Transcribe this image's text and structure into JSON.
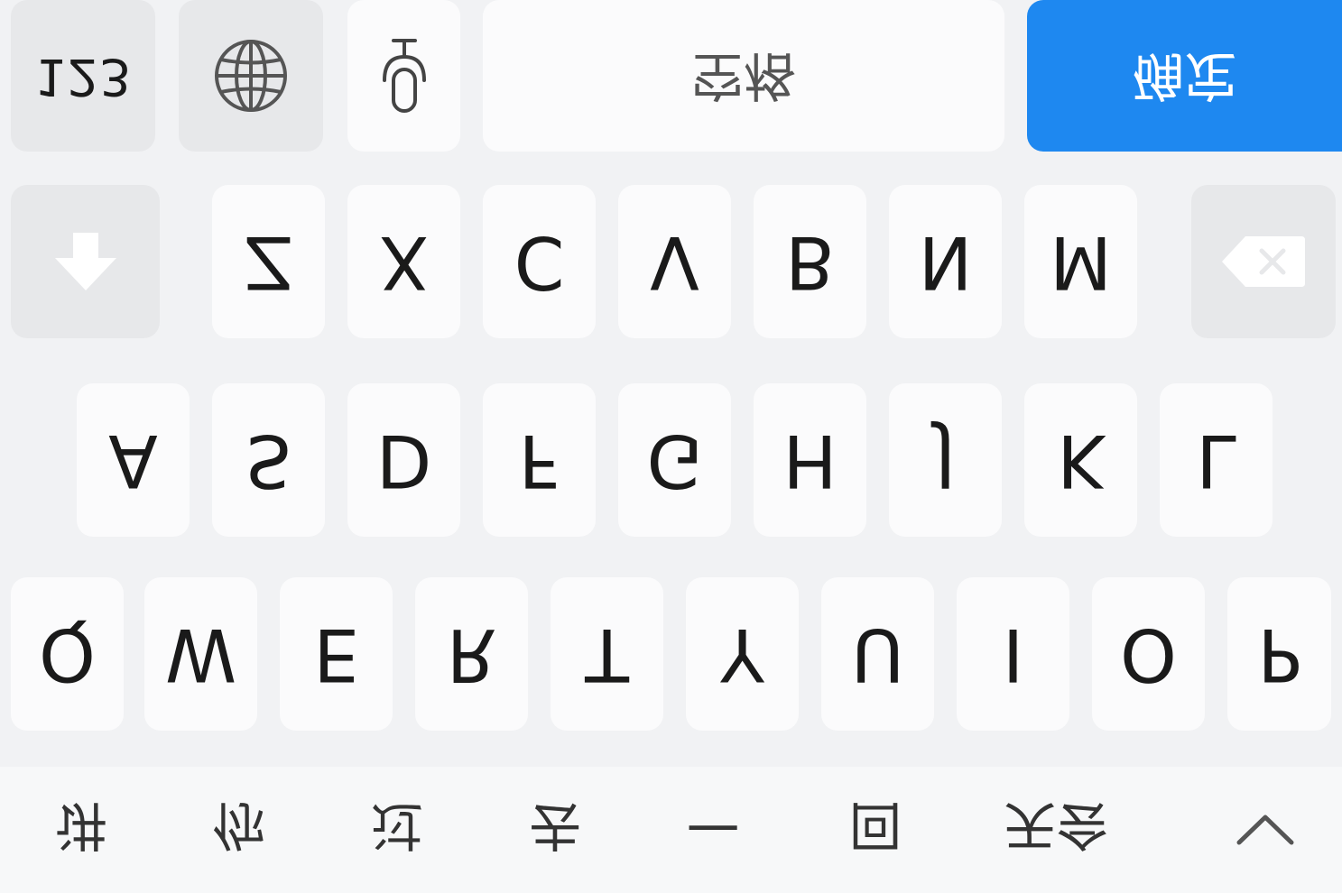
{
  "suggestions": [
    "天会",
    "回",
    "一",
    "去",
    "过",
    "你",
    "讲"
  ],
  "rows": {
    "top": [
      "Q",
      "W",
      "E",
      "R",
      "T",
      "Y",
      "U",
      "I",
      "O",
      "P"
    ],
    "middle": [
      "A",
      "S",
      "D",
      "F",
      "G",
      "H",
      "J",
      "K",
      "L"
    ],
    "bottom": [
      "Z",
      "X",
      "C",
      "V",
      "B",
      "N",
      "M"
    ]
  },
  "bottom_bar": {
    "numbers_label": "123",
    "space_label": "空格",
    "confirm_label": "确定"
  },
  "colors": {
    "accent": "#1e88f0",
    "key_bg": "#fbfbfc",
    "func_key_bg": "#e7e8ea",
    "keyboard_bg": "#f1f2f4"
  },
  "icons": {
    "collapse": "chevron-down-icon",
    "shift": "shift-arrow-icon",
    "backspace": "backspace-icon",
    "globe": "globe-icon",
    "microphone": "microphone-icon"
  }
}
